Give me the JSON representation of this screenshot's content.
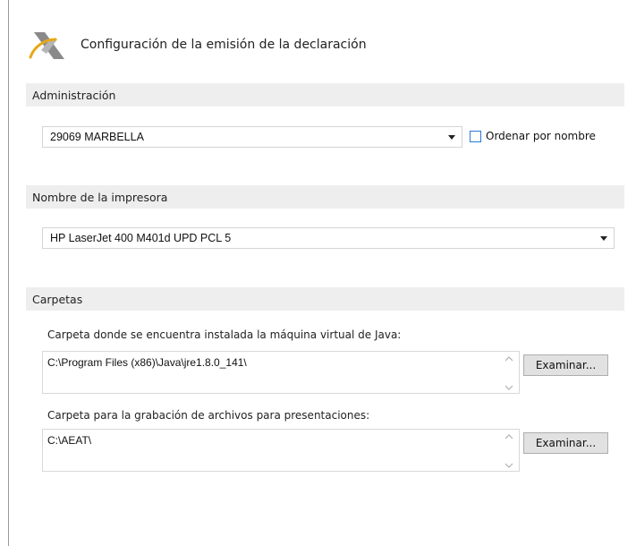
{
  "header": {
    "title": "Configuración de la emisión de la declaración"
  },
  "administracion": {
    "section_label": "Administración",
    "selected": "29069 MARBELLA",
    "checkbox_label": "Ordenar por nombre",
    "checkbox_checked": false
  },
  "impresora": {
    "section_label": "Nombre de la impresora",
    "selected": "HP LaserJet 400 M401d UPD PCL 5"
  },
  "carpetas": {
    "section_label": "Carpetas",
    "java": {
      "label": "Carpeta donde se encuentra instalada la máquina virtual de Java:",
      "value": "C:\\Program Files (x86)\\Java\\jre1.8.0_141\\",
      "button_label": "Examinar..."
    },
    "grabacion": {
      "label": "Carpeta para la grabación de archivos para presentaciones:",
      "value": "C:\\AEAT\\",
      "button_label": "Examinar..."
    }
  },
  "icons": {
    "logo": "aeat-logo",
    "dropdown": "chevron-down-icon",
    "scroll_up": "chevron-up-icon",
    "scroll_down": "chevron-down-icon"
  },
  "colors": {
    "section_bg": "#eeeeee",
    "checkbox_border": "#2b78d6",
    "logo_gold": "#e6a817",
    "logo_gray": "#8a8a8a"
  }
}
